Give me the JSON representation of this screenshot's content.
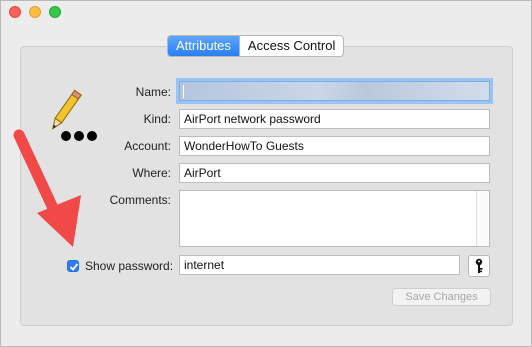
{
  "window": {
    "controls": [
      "close",
      "minimize",
      "zoom"
    ]
  },
  "tabs": [
    {
      "label": "Attributes",
      "active": true
    },
    {
      "label": "Access Control",
      "active": false
    }
  ],
  "form": {
    "name_label": "Name:",
    "name_value": "",
    "kind_label": "Kind:",
    "kind_value": "AirPort network password",
    "account_label": "Account:",
    "account_value": "WonderHowTo Guests",
    "where_label": "Where:",
    "where_value": "AirPort",
    "comments_label": "Comments:",
    "comments_value": "",
    "show_password_label": "Show password:",
    "show_password_checked": true,
    "password_value": "internet",
    "save_label": "Save Changes"
  },
  "icons": {
    "item": "keychain-pencil-dots-icon",
    "key_button": "key-icon",
    "annotation": "red-arrow"
  },
  "colors": {
    "accent": "#2a7ef3",
    "annotation_arrow": "#f14848"
  }
}
